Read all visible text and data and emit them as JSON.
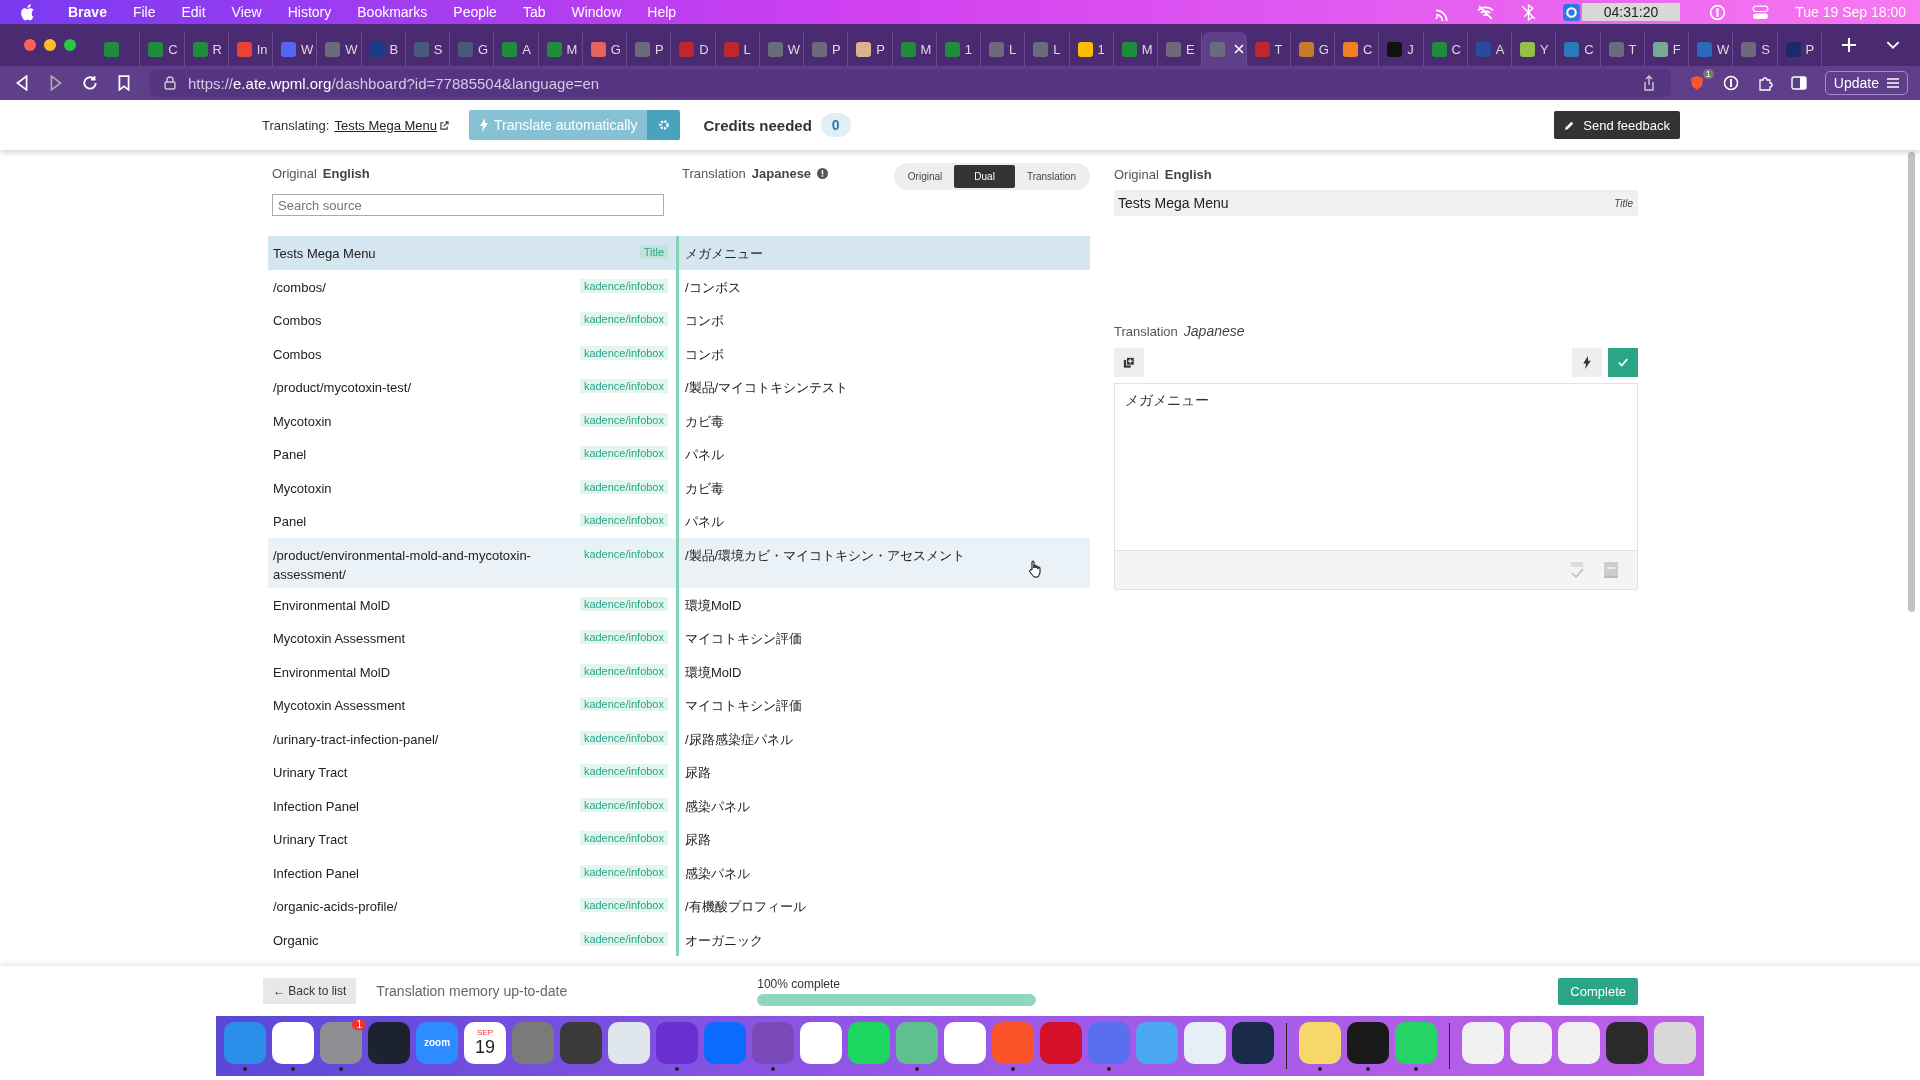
{
  "menu_bar": {
    "app": "Brave",
    "items": [
      "File",
      "Edit",
      "View",
      "History",
      "Bookmarks",
      "People",
      "Tab",
      "Window",
      "Help"
    ],
    "timer": "04:31:20",
    "clock": "Tue 19 Sep  18:00"
  },
  "browser": {
    "tabs": [
      {
        "color": "#1e8e3e",
        "selected": false
      },
      {
        "label": "C",
        "color": "#1e8e3e",
        "selected": false
      },
      {
        "label": "R",
        "color": "#1e8e3e",
        "selected": false
      },
      {
        "label": "In",
        "color": "#ea4335",
        "selected": false
      },
      {
        "label": "W",
        "color": "#5865f2",
        "selected": false
      },
      {
        "label": "W",
        "color": "#6b6b7b",
        "selected": false
      },
      {
        "label": "B",
        "color": "#1a3a8a",
        "selected": false
      },
      {
        "label": "S",
        "color": "#4a5a7a",
        "selected": false
      },
      {
        "label": "G",
        "color": "#4a5a7a",
        "selected": false
      },
      {
        "label": "A",
        "color": "#1e8e3e",
        "selected": false
      },
      {
        "label": "M",
        "color": "#1e8e3e",
        "selected": false
      },
      {
        "label": "G",
        "color": "#e8635a",
        "selected": false
      },
      {
        "label": "P",
        "color": "#6b6b7b",
        "selected": false
      },
      {
        "label": "D",
        "color": "#c0262d",
        "selected": false
      },
      {
        "label": "L",
        "color": "#c0262d",
        "selected": false
      },
      {
        "label": "W",
        "color": "#6b6b7b",
        "selected": false
      },
      {
        "label": "P",
        "color": "#6b6b7b",
        "selected": false
      },
      {
        "label": "P",
        "color": "#d9b38c",
        "selected": false
      },
      {
        "label": "M",
        "color": "#1e8e3e",
        "selected": false
      },
      {
        "label": "1",
        "color": "#1e8e3e",
        "selected": false
      },
      {
        "label": "L",
        "color": "#6b6b7b",
        "selected": false
      },
      {
        "label": "L",
        "color": "#6b6b7b",
        "selected": false
      },
      {
        "label": "1",
        "color": "#fbbc04",
        "selected": false
      },
      {
        "label": "M",
        "color": "#1e8e3e",
        "selected": false
      },
      {
        "label": "E",
        "color": "#6b6b7b",
        "selected": false
      },
      {
        "color": "#6b6b7b",
        "selected": true
      },
      {
        "label": "T",
        "color": "#c0262d",
        "selected": false
      },
      {
        "label": "G",
        "color": "#c77b2a",
        "selected": false
      },
      {
        "label": "C",
        "color": "#f38020",
        "selected": false
      },
      {
        "label": "J",
        "color": "#111111",
        "selected": false
      },
      {
        "label": "C",
        "color": "#1e8e3e",
        "selected": false
      },
      {
        "label": "A",
        "color": "#2a4a9a",
        "selected": false
      },
      {
        "label": "Y",
        "color": "#95bf47",
        "selected": false
      },
      {
        "label": "C",
        "color": "#2a7ab8",
        "selected": false
      },
      {
        "label": "T",
        "color": "#6b6b7b",
        "selected": false
      },
      {
        "label": "F",
        "color": "#74aa9c",
        "selected": false
      },
      {
        "label": "W",
        "color": "#2a6ab8",
        "selected": false
      },
      {
        "label": "S",
        "color": "#6b6b7b",
        "selected": false
      },
      {
        "label": "P",
        "color": "#1a2a6a",
        "selected": false
      }
    ],
    "url": "https://**e.ate.wpml.org**/dashboard?id=77885504&language=en",
    "update_button": "Update",
    "shields_badge": "1"
  },
  "header": {
    "translating_label": "Translating:",
    "document_link": "Tests Mega Menu",
    "auto_button": "Translate automatically",
    "credits_label": "Credits needed",
    "credits": "0",
    "feedback_button": "Send feedback"
  },
  "source_pane": {
    "original_label": "Original",
    "original_language": "English",
    "translation_label": "Translation",
    "translation_language": "Japanese",
    "search": {
      "placeholder": "Search source"
    },
    "view_modes": [
      {
        "label": "Original",
        "selected": false
      },
      {
        "label": "Dual",
        "selected": true
      },
      {
        "label": "Translation",
        "selected": false
      }
    ],
    "rows": [
      {
        "source": "Tests Mega Menu",
        "tag": "Title",
        "kind": "title",
        "target": "メガメニュー",
        "selected": true,
        "hovered": false
      },
      {
        "source": "/combos/",
        "tag": "kadence/infobox",
        "kind": "block",
        "target": "/コンボス",
        "selected": false,
        "hovered": false
      },
      {
        "source": "Combos",
        "tag": "kadence/infobox",
        "kind": "block",
        "target": "コンボ",
        "selected": false,
        "hovered": false
      },
      {
        "source": "Combos",
        "tag": "kadence/infobox",
        "kind": "block",
        "target": "コンボ",
        "selected": false,
        "hovered": false
      },
      {
        "source": "/product/mycotoxin-test/",
        "tag": "kadence/infobox",
        "kind": "block",
        "target": "/製品/マイコトキシンテスト",
        "selected": false,
        "hovered": false
      },
      {
        "source": "Mycotoxin",
        "tag": "kadence/infobox",
        "kind": "block",
        "target": "カビ毒",
        "selected": false,
        "hovered": false
      },
      {
        "source": "Panel",
        "tag": "kadence/infobox",
        "kind": "block",
        "target": "パネル",
        "selected": false,
        "hovered": false
      },
      {
        "source": "Mycotoxin",
        "tag": "kadence/infobox",
        "kind": "block",
        "target": "カビ毒",
        "selected": false,
        "hovered": false
      },
      {
        "source": "Panel",
        "tag": "kadence/infobox",
        "kind": "block",
        "target": "パネル",
        "selected": false,
        "hovered": false
      },
      {
        "source": "/product/environmental-mold-and-mycotoxin-assessment/",
        "tag": "kadence/infobox",
        "kind": "block",
        "target": "/製品/環境カビ・マイコトキシン・アセスメント",
        "selected": false,
        "hovered": true
      },
      {
        "source": "Environmental MolD",
        "tag": "kadence/infobox",
        "kind": "block",
        "target": "環境MolD",
        "selected": false,
        "hovered": false
      },
      {
        "source": "Mycotoxin Assessment",
        "tag": "kadence/infobox",
        "kind": "block",
        "target": "マイコトキシン評価",
        "selected": false,
        "hovered": false
      },
      {
        "source": "Environmental MolD",
        "tag": "kadence/infobox",
        "kind": "block",
        "target": "環境MolD",
        "selected": false,
        "hovered": false
      },
      {
        "source": "Mycotoxin Assessment",
        "tag": "kadence/infobox",
        "kind": "block",
        "target": "マイコトキシン評価",
        "selected": false,
        "hovered": false
      },
      {
        "source": "/urinary-tract-infection-panel/",
        "tag": "kadence/infobox",
        "kind": "block",
        "target": "/尿路感染症パネル",
        "selected": false,
        "hovered": false
      },
      {
        "source": "Urinary Tract",
        "tag": "kadence/infobox",
        "kind": "block",
        "target": "尿路",
        "selected": false,
        "hovered": false
      },
      {
        "source": "Infection Panel",
        "tag": "kadence/infobox",
        "kind": "block",
        "target": "感染パネル",
        "selected": false,
        "hovered": false
      },
      {
        "source": "Urinary Tract",
        "tag": "kadence/infobox",
        "kind": "block",
        "target": "尿路",
        "selected": false,
        "hovered": false
      },
      {
        "source": "Infection Panel",
        "tag": "kadence/infobox",
        "kind": "block",
        "target": "感染パネル",
        "selected": false,
        "hovered": false
      },
      {
        "source": "/organic-acids-profile/",
        "tag": "kadence/infobox",
        "kind": "block",
        "target": "/有機酸プロフィール",
        "selected": false,
        "hovered": false
      },
      {
        "source": "Organic",
        "tag": "kadence/infobox",
        "kind": "block",
        "target": "オーガニック",
        "selected": false,
        "hovered": false
      }
    ]
  },
  "editor": {
    "original_label": "Original",
    "original_language": "English",
    "original_text": "Tests Mega Menu",
    "original_type": "Title",
    "translation_label": "Translation",
    "translation_language": "Japanese",
    "translation_text": "メガメニュー"
  },
  "footer": {
    "back_button": "← Back to list",
    "memory_status": "Translation memory up-to-date",
    "progress_label": "100% complete",
    "level": 1.0,
    "complete_button": "Complete"
  },
  "dock": {
    "groups": [
      [
        {
          "color": "#2a8ee8",
          "running": true
        },
        {
          "color": "#ffffff",
          "running": true
        },
        {
          "color": "#8e8e93",
          "running": true,
          "badge": "1"
        },
        {
          "color": "#1c2230",
          "running": false
        },
        {
          "color": "#2d8cff",
          "running": false,
          "label": "zoom"
        },
        {
          "color": "#ffffff",
          "running": false,
          "month": "SEP",
          "label": "19"
        },
        {
          "color": "#7a7a7a",
          "running": false
        },
        {
          "color": "#3a3a3a",
          "running": false
        },
        {
          "color": "#dfe6ee",
          "running": false
        },
        {
          "color": "#6a2fd0",
          "running": true
        },
        {
          "color": "#0a6cff",
          "running": false
        },
        {
          "color": "#7a4ab8",
          "running": true
        },
        {
          "color": "#ffffff",
          "running": false
        },
        {
          "color": "#1ed760",
          "running": false
        },
        {
          "color": "#5fbf8f",
          "running": true
        },
        {
          "color": "#ffffff",
          "running": false
        },
        {
          "color": "#fb542b",
          "running": true
        },
        {
          "color": "#d4102a",
          "running": false
        },
        {
          "color": "#5a6ef0",
          "running": true
        },
        {
          "color": "#4aa8f0",
          "running": false
        },
        {
          "color": "#e8eef8",
          "running": false
        },
        {
          "color": "#1a2a4a",
          "running": false
        }
      ],
      [
        {
          "color": "#f6d76a",
          "running": true
        },
        {
          "color": "#1a1a1a",
          "running": true
        },
        {
          "color": "#25d366",
          "running": true
        }
      ],
      [
        {
          "color": "#f0f0f0",
          "running": false
        },
        {
          "color": "#f0f0f0",
          "running": false
        },
        {
          "color": "#f0f0f0",
          "running": false
        },
        {
          "color": "#2a2a2a",
          "running": false
        },
        {
          "color": "#d8d8d8",
          "running": false
        }
      ]
    ]
  }
}
